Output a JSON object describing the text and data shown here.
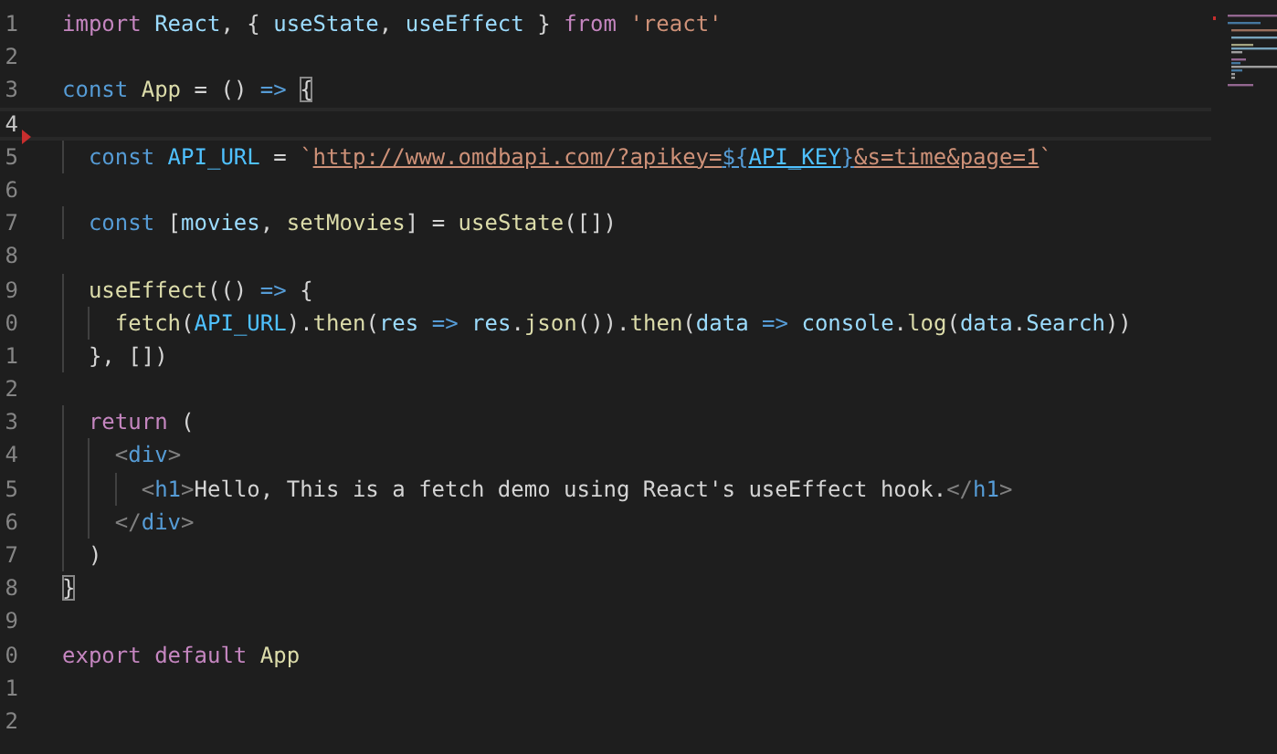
{
  "editor": {
    "lines": [
      {
        "number": "1",
        "current": false,
        "marker": false,
        "tokens": [
          {
            "text": "import ",
            "kind": "control"
          },
          {
            "text": "React",
            "kind": "variable"
          },
          {
            "text": ", { ",
            "kind": "plain"
          },
          {
            "text": "useState",
            "kind": "variable"
          },
          {
            "text": ", ",
            "kind": "plain"
          },
          {
            "text": "useEffect",
            "kind": "variable"
          },
          {
            "text": " } ",
            "kind": "plain"
          },
          {
            "text": "from ",
            "kind": "control"
          },
          {
            "text": "'react'",
            "kind": "string"
          }
        ]
      },
      {
        "number": "2",
        "current": false,
        "marker": false
      },
      {
        "number": "3",
        "current": false,
        "marker": false,
        "tokens": [
          {
            "text": "const ",
            "kind": "keyword"
          },
          {
            "text": "App",
            "kind": "function"
          },
          {
            "text": " = () ",
            "kind": "plain"
          },
          {
            "text": "=> ",
            "kind": "keyword"
          },
          {
            "text": "{",
            "kind": "matched"
          }
        ]
      },
      {
        "number": "4",
        "current": true,
        "marker": true
      },
      {
        "number": "5",
        "current": false,
        "marker": false,
        "tokens": [
          {
            "text": "  const ",
            "kind": "keyword"
          },
          {
            "text": "API_URL",
            "kind": "constant"
          },
          {
            "text": " = ",
            "kind": "plain"
          },
          {
            "text": "`",
            "kind": "string"
          },
          {
            "text": "http://www.omdbapi.com/?apikey=",
            "kind": "link"
          },
          {
            "text": "${",
            "kind": "interpolation"
          },
          {
            "text": "API_KEY",
            "kind": "interpolated"
          },
          {
            "text": "}",
            "kind": "interpolation"
          },
          {
            "text": "&s=time&page=1",
            "kind": "link"
          },
          {
            "text": "`",
            "kind": "string"
          }
        ]
      },
      {
        "number": "6",
        "current": false,
        "marker": false
      },
      {
        "number": "7",
        "current": false,
        "marker": false,
        "tokens": [
          {
            "text": "  const ",
            "kind": "keyword"
          },
          {
            "text": "[",
            "kind": "plain"
          },
          {
            "text": "movies",
            "kind": "variable"
          },
          {
            "text": ", ",
            "kind": "plain"
          },
          {
            "text": "setMovies",
            "kind": "function"
          },
          {
            "text": "] = ",
            "kind": "plain"
          },
          {
            "text": "useState",
            "kind": "function"
          },
          {
            "text": "([])",
            "kind": "plain"
          }
        ]
      },
      {
        "number": "8",
        "current": false,
        "marker": false
      },
      {
        "number": "9",
        "current": false,
        "marker": false,
        "tokens": [
          {
            "text": "  useEffect",
            "kind": "function"
          },
          {
            "text": "(() ",
            "kind": "plain"
          },
          {
            "text": "=>",
            "kind": "keyword"
          },
          {
            "text": " {",
            "kind": "plain"
          }
        ]
      },
      {
        "number": "0",
        "current": false,
        "marker": false,
        "tokens": [
          {
            "text": "    fetch",
            "kind": "function"
          },
          {
            "text": "(",
            "kind": "plain"
          },
          {
            "text": "API_URL",
            "kind": "constant"
          },
          {
            "text": ").",
            "kind": "plain"
          },
          {
            "text": "then",
            "kind": "function"
          },
          {
            "text": "(",
            "kind": "plain"
          },
          {
            "text": "res ",
            "kind": "variable"
          },
          {
            "text": "=> ",
            "kind": "keyword"
          },
          {
            "text": "res",
            "kind": "variable"
          },
          {
            "text": ".",
            "kind": "plain"
          },
          {
            "text": "json",
            "kind": "function"
          },
          {
            "text": "()).",
            "kind": "plain"
          },
          {
            "text": "then",
            "kind": "function"
          },
          {
            "text": "(",
            "kind": "plain"
          },
          {
            "text": "data ",
            "kind": "variable"
          },
          {
            "text": "=> ",
            "kind": "keyword"
          },
          {
            "text": "console",
            "kind": "variable"
          },
          {
            "text": ".",
            "kind": "plain"
          },
          {
            "text": "log",
            "kind": "function"
          },
          {
            "text": "(",
            "kind": "plain"
          },
          {
            "text": "data",
            "kind": "variable"
          },
          {
            "text": ".",
            "kind": "plain"
          },
          {
            "text": "Search",
            "kind": "variable"
          },
          {
            "text": "))",
            "kind": "plain"
          }
        ]
      },
      {
        "number": "1",
        "current": false,
        "marker": false,
        "tokens": [
          {
            "text": "  }, [])",
            "kind": "plain"
          }
        ]
      },
      {
        "number": "2",
        "current": false,
        "marker": false
      },
      {
        "number": "3",
        "current": false,
        "marker": false,
        "tokens": [
          {
            "text": "  return",
            "kind": "control"
          },
          {
            "text": " (",
            "kind": "plain"
          }
        ]
      },
      {
        "number": "4",
        "current": false,
        "marker": false,
        "tokens": [
          {
            "text": "    <",
            "kind": "tag-bracket"
          },
          {
            "text": "div",
            "kind": "tag"
          },
          {
            "text": ">",
            "kind": "tag-bracket"
          }
        ]
      },
      {
        "number": "5",
        "current": false,
        "marker": false,
        "tokens": [
          {
            "text": "      <",
            "kind": "tag-bracket"
          },
          {
            "text": "h1",
            "kind": "tag"
          },
          {
            "text": ">",
            "kind": "tag-bracket"
          },
          {
            "text": "Hello, This is a fetch demo using React's useEffect hook.",
            "kind": "plain"
          },
          {
            "text": "</",
            "kind": "tag-bracket"
          },
          {
            "text": "h1",
            "kind": "tag"
          },
          {
            "text": ">",
            "kind": "tag-bracket"
          }
        ]
      },
      {
        "number": "6",
        "current": false,
        "marker": false,
        "tokens": [
          {
            "text": "    </",
            "kind": "tag-bracket"
          },
          {
            "text": "div",
            "kind": "tag"
          },
          {
            "text": ">",
            "kind": "tag-bracket"
          }
        ]
      },
      {
        "number": "7",
        "current": false,
        "marker": false,
        "tokens": [
          {
            "text": "  )",
            "kind": "plain"
          }
        ]
      },
      {
        "number": "8",
        "current": false,
        "marker": false,
        "tokens": [
          {
            "text": "}",
            "kind": "matched"
          }
        ]
      },
      {
        "number": "9",
        "current": false,
        "marker": false
      },
      {
        "number": "0",
        "current": false,
        "marker": false,
        "tokens": [
          {
            "text": "export default ",
            "kind": "control"
          },
          {
            "text": "App",
            "kind": "function"
          }
        ]
      },
      {
        "number": "1",
        "current": false,
        "marker": false
      },
      {
        "number": "2",
        "current": false,
        "marker": false
      }
    ]
  }
}
